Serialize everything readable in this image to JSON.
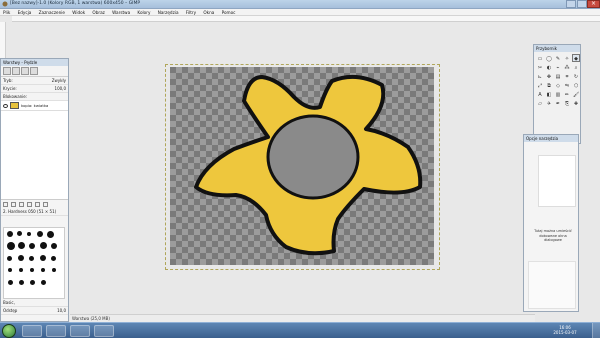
{
  "window": {
    "title": "[Bez nazwy]-1.0 (Kolory RGB, 1 warstwa) 600x450 – GIMP"
  },
  "menu": {
    "items": [
      "Plik",
      "Edycja",
      "Zaznaczenie",
      "Widok",
      "Obraz",
      "Warstwa",
      "Kolory",
      "Narzędzia",
      "Filtry",
      "Okna",
      "Pomoc"
    ]
  },
  "layers_dock": {
    "title": "Warstwy - Pędzle",
    "mode_label": "Tryb:",
    "mode_value": "Zwykły",
    "opacity_label": "Krycie:",
    "opacity_value": "100,0",
    "lock_label": "Blokowanie:",
    "layer_name": "kopia: kwiatka",
    "brushes_label": "2. Hardness 050 (51 × 51)",
    "spacing_label": "Odstęp",
    "spacing_value": "10,0",
    "brush_tag": "Basic,"
  },
  "toolbox": {
    "title": "Przybornik"
  },
  "tool_options": {
    "title": "Opcje narzędzia",
    "note": "Tutaj można umieścić dokowane okna dialogowe"
  },
  "status": {
    "text": "Warstwa (25,0 MB)"
  },
  "taskbar": {
    "time": "16:06",
    "date": "2015-03-07"
  },
  "colors": {
    "petal": "#eec73d",
    "outline": "#111111",
    "checker_dark": "#7a7a7a",
    "checker_light": "#9c9c9c"
  }
}
